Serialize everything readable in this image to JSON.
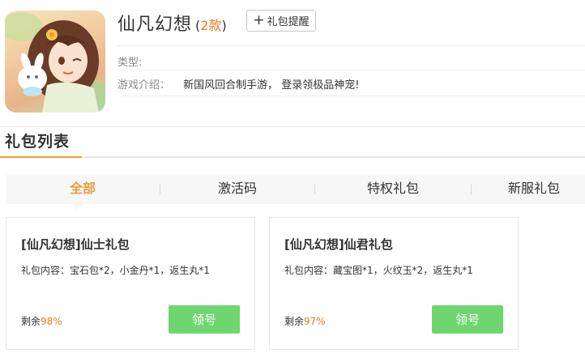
{
  "game": {
    "name": "仙凡幻想",
    "count_open": "(",
    "count_num": "2款",
    "count_close": ")",
    "remind_label": "礼包提醒",
    "type_label": "类型:",
    "intro_label": "游戏介绍：",
    "intro_text": "新国风回合制手游， 登录领极品神宠!"
  },
  "section": {
    "title": "礼包列表"
  },
  "tabs": [
    {
      "label": "全部",
      "active": true
    },
    {
      "label": "激活码",
      "active": false
    },
    {
      "label": "特权礼包",
      "active": false
    },
    {
      "label": "新服礼包",
      "active": false
    }
  ],
  "cards": [
    {
      "title": "[仙凡幻想]仙士礼包",
      "content": "礼包内容：宝石包*2，小金丹*1，返生丸*1",
      "remain_label": "剩余",
      "remain_pct": "98%",
      "button": "领号"
    },
    {
      "title": "[仙凡幻想]仙君礼包",
      "content": "礼包内容：藏宝图*1，火纹玉*2，返生丸*1",
      "remain_label": "剩余",
      "remain_pct": "97%",
      "button": "领号"
    }
  ],
  "colors": {
    "accent": "#f09a3a",
    "count": "#e67e22",
    "claim_button": "#6fd66f"
  }
}
